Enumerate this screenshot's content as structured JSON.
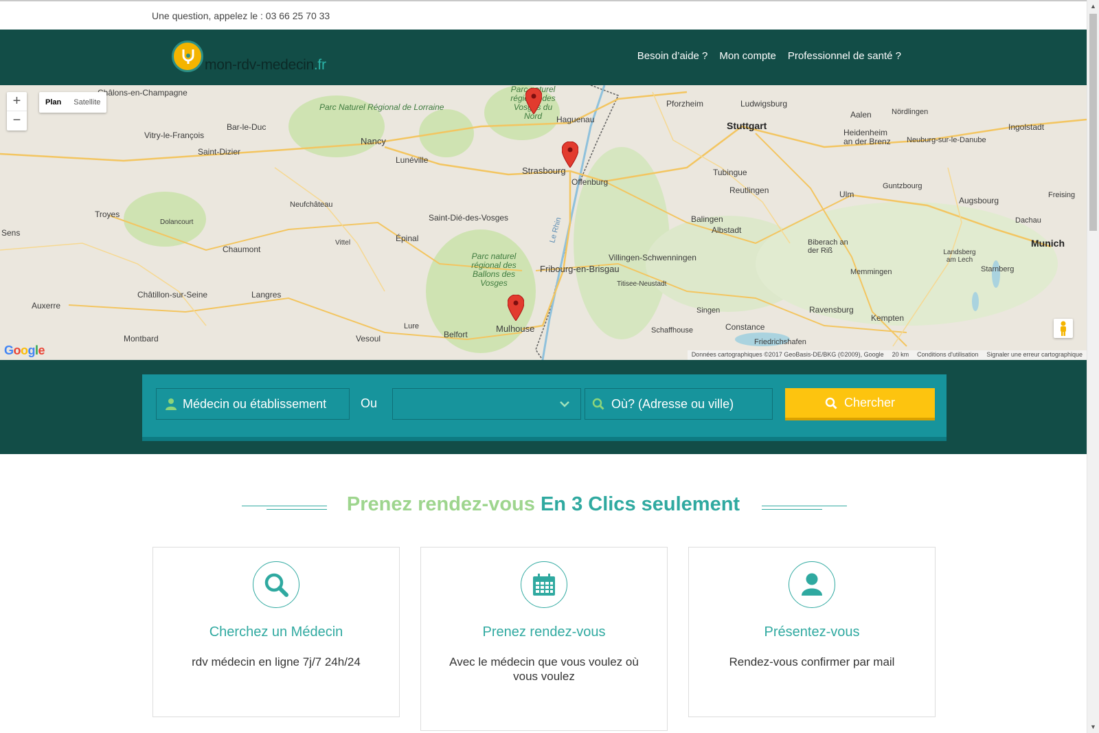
{
  "topbar": {
    "phone_text": "Une question, appelez le : 03 66 25 70 33"
  },
  "header": {
    "logo_text": "mon-rdv-medecin",
    "logo_tld": ".fr",
    "nav": [
      {
        "label": "Besoin d’aide ?"
      },
      {
        "label": "Mon compte"
      },
      {
        "label": "Professionnel de santé ?"
      }
    ]
  },
  "map": {
    "zoom_in": "+",
    "zoom_out": "−",
    "type_plan": "Plan",
    "type_satellite": "Satellite",
    "google": "Google",
    "attribution": {
      "data": "Données cartographiques ©2017 GeoBasis-DE/BKG (©2009), Google",
      "scale": "20 km",
      "terms": "Conditions d'utilisation",
      "report": "Signaler une erreur cartographique"
    },
    "cities": {
      "chalons": "Châlons-en-Champagne",
      "vitry": "Vitry-le-François",
      "bar_le_duc": "Bar-le-Duc",
      "saint_dizier": "Saint-Dizier",
      "nancy": "Nancy",
      "luneville": "Lunéville",
      "haguenau": "Haguenau",
      "strasbourg": "Strasbourg",
      "offenburg": "Offenburg",
      "pforzheim": "Pforzheim",
      "ludwigsburg": "Ludwigsburg",
      "stuttgart": "Stuttgart",
      "aalen": "Aalen",
      "nordlingen": "Nördlingen",
      "heidenheim": "Heidenheim an der Brenz",
      "neuburg": "Neuburg-sur-le-Danube",
      "ingolstadt": "Ingolstadt",
      "troyes": "Troyes",
      "dolancourt": "Dolancourt",
      "neufchateau": "Neufchâteau",
      "saint_die": "Saint-Dié-des-Vosges",
      "tubingue": "Tubingue",
      "reutlingen": "Reutlingen",
      "ulm": "Ulm",
      "guntzbourg": "Guntzbourg",
      "augsbourg": "Augsbourg",
      "freising": "Freising",
      "sens": "Sens",
      "chaumont": "Chaumont",
      "vittel": "Vittel",
      "epinal": "Épinal",
      "balingen": "Balingen",
      "albstadt": "Albstadt",
      "dachau": "Dachau",
      "munich": "Munich",
      "villingen": "Villingen-Schwenningen",
      "fribourg": "Fribourg-en-Brisgau",
      "titisee": "Titisee-Neustadt",
      "biberach": "Biberach an der Riß",
      "memmingen": "Memmingen",
      "landsberg": "Landsberg am Lech",
      "starnberg": "Starnberg",
      "chatillon": "Châtillon-sur-Seine",
      "langres": "Langres",
      "auxerre": "Auxerre",
      "ravensburg": "Ravensburg",
      "kempten": "Kempten",
      "singen": "Singen",
      "constance": "Constance",
      "schaffhouse": "Schaffhouse",
      "friedrichshafen": "Friedrichshafen",
      "montbard": "Montbard",
      "vesoul": "Vesoul",
      "lure": "Lure",
      "belfort": "Belfort",
      "mulhouse": "Mulhouse"
    },
    "parks": {
      "lorraine": "Parc Naturel Régional de Lorraine",
      "vosges_nord": "Parc naturel régional des Vosges du Nord",
      "ballons": "Parc naturel régional des Ballons des Vosges"
    },
    "river": "Le Rhin"
  },
  "search": {
    "doctor_label": "Médecin ou établissement",
    "or_label": "Ou",
    "specialty_value": "",
    "where_placeholder": "Où? (Adresse ou ville)",
    "button_label": "Chercher"
  },
  "headline": {
    "light": "Prenez rendez-vous",
    "strong": "En 3 Clics seulement"
  },
  "steps": [
    {
      "icon": "search-icon",
      "title": "Cherchez un Médecin",
      "text": "rdv médecin en ligne 7j/7 24h/24"
    },
    {
      "icon": "calendar-icon",
      "title": "Prenez rendez-vous",
      "text": "Avec le médecin que vous voulez où vous voulez"
    },
    {
      "icon": "user-icon",
      "title": "Présentez-vous",
      "text": "Rendez-vous confirmer par mail"
    }
  ],
  "colors": {
    "header_bg": "#124d47",
    "search_bg": "#17949c",
    "accent": "#2fa9a0",
    "button": "#fdc40f",
    "headline_light": "#9ed58e"
  }
}
